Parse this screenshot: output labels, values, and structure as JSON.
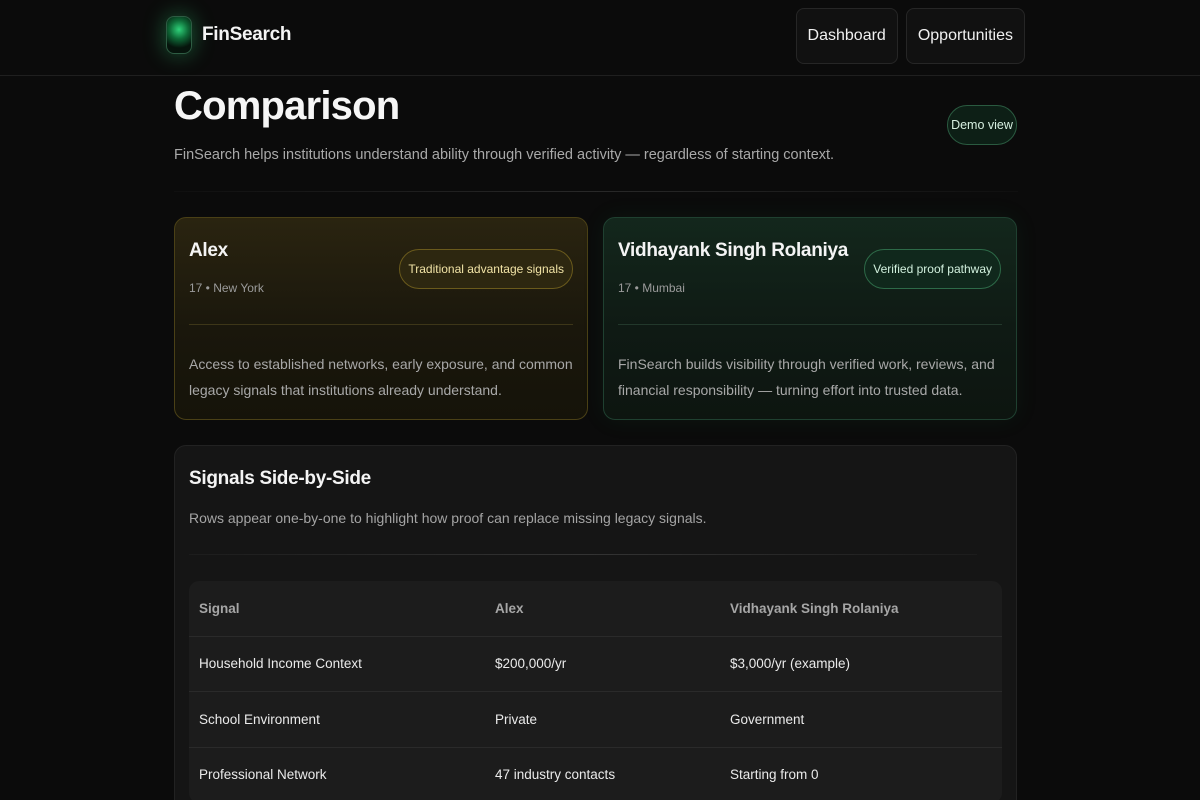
{
  "brand": {
    "name": "FinSearch"
  },
  "nav": {
    "dashboard": "Dashboard",
    "opportunities": "Opportunities"
  },
  "header": {
    "title": "Comparison",
    "subtitle": "FinSearch helps institutions understand ability through verified activity — regardless of starting context.",
    "demo_label": "Demo view"
  },
  "profiles": [
    {
      "name": "Alex",
      "meta": "17 • New York",
      "badge": "Traditional advantage signals",
      "description": "Access to established networks, early exposure, and common legacy signals that institutions already understand."
    },
    {
      "name": "Vidhayank Singh Rolaniya",
      "meta": "17 • Mumbai",
      "badge": "Verified proof pathway",
      "description": "FinSearch builds visibility through verified work, reviews, and financial responsibility — turning effort into trusted data."
    }
  ],
  "signals": {
    "title": "Signals Side-by-Side",
    "subtitle": "Rows appear one-by-one to highlight how proof can replace missing legacy signals.",
    "columns": [
      "Signal",
      "Alex",
      "Vidhayank Singh Rolaniya"
    ],
    "rows": [
      [
        "Household Income Context",
        "$200,000/yr",
        "$3,000/yr (example)"
      ],
      [
        "School Environment",
        "Private",
        "Government"
      ],
      [
        "Professional Network",
        "47 industry contacts",
        "Starting from 0"
      ]
    ]
  },
  "colors": {
    "background": "#0b0b0b",
    "accent_green": "#2fd27a",
    "alex_gold": "#6a5a1c",
    "verified_green": "#2d6a48"
  }
}
